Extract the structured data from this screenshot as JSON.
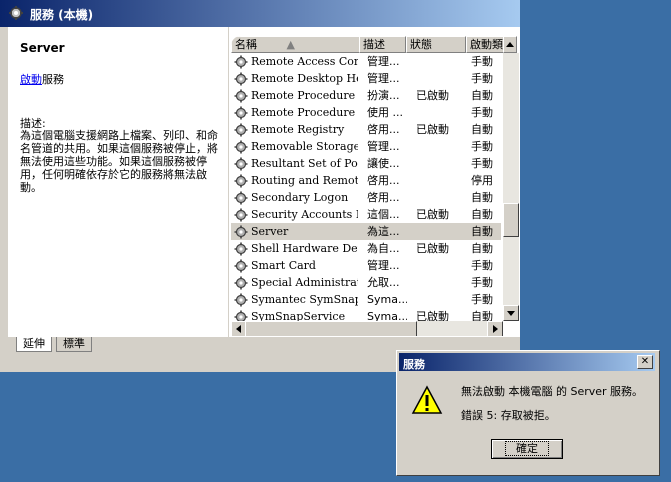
{
  "window": {
    "title": "服務 (本機)"
  },
  "left": {
    "heading": "Server",
    "start_link": "啟動",
    "start_suffix": "服務",
    "desc_label": "描述:",
    "desc_text": "為這個電腦支援網路上檔案、列印、和命名管道的共用。如果這個服務被停止，將無法使用這些功能。如果這個服務被停用，任何明確依存於它的服務將無法啟動。"
  },
  "list": {
    "columns": [
      "名稱",
      "描述",
      "狀態",
      "啟動類"
    ],
    "rows": [
      {
        "name": "Remote Access Con...",
        "desc": "管理...",
        "status": "",
        "start": "手動"
      },
      {
        "name": "Remote Desktop Hel...",
        "desc": "管理...",
        "status": "",
        "start": "手動"
      },
      {
        "name": "Remote Procedure C...",
        "desc": "扮演...",
        "status": "已啟動",
        "start": "自動"
      },
      {
        "name": "Remote Procedure C...",
        "desc": "使用 ...",
        "status": "",
        "start": "手動"
      },
      {
        "name": "Remote Registry",
        "desc": "啓用...",
        "status": "已啟動",
        "start": "自動"
      },
      {
        "name": "Removable Storage",
        "desc": "管理...",
        "status": "",
        "start": "手動"
      },
      {
        "name": "Resultant Set of Poli...",
        "desc": "讓使...",
        "status": "",
        "start": "手動"
      },
      {
        "name": "Routing and Remote...",
        "desc": "啓用...",
        "status": "",
        "start": "停用"
      },
      {
        "name": "Secondary Logon",
        "desc": "啓用...",
        "status": "",
        "start": "自動"
      },
      {
        "name": "Security Accounts M...",
        "desc": "這個...",
        "status": "已啟動",
        "start": "自動"
      },
      {
        "name": "Server",
        "desc": "為這...",
        "status": "",
        "start": "自動"
      },
      {
        "name": "Shell Hardware Dete...",
        "desc": "為自...",
        "status": "已啟動",
        "start": "自動"
      },
      {
        "name": "Smart Card",
        "desc": "管理...",
        "status": "",
        "start": "手動"
      },
      {
        "name": "Special Administrati...",
        "desc": "允取...",
        "status": "",
        "start": "手動"
      },
      {
        "name": "Symantec SymSnap ...",
        "desc": "Syma...",
        "status": "",
        "start": "手動"
      },
      {
        "name": "SymSnapService",
        "desc": "Syma...",
        "status": "已啟動",
        "start": "自動"
      }
    ]
  },
  "tabs": [
    "延伸",
    "標準"
  ],
  "dialog": {
    "title": "服務",
    "message": "無法啟動 本機電腦 的 Server 服務。",
    "error": "錯誤 5: 存取被拒。",
    "ok_label": "確定",
    "close_glyph": "✕"
  },
  "colors": {
    "title_active": "#0a246a",
    "desktop": "#3a6ea5",
    "face": "#d4d0c8"
  }
}
